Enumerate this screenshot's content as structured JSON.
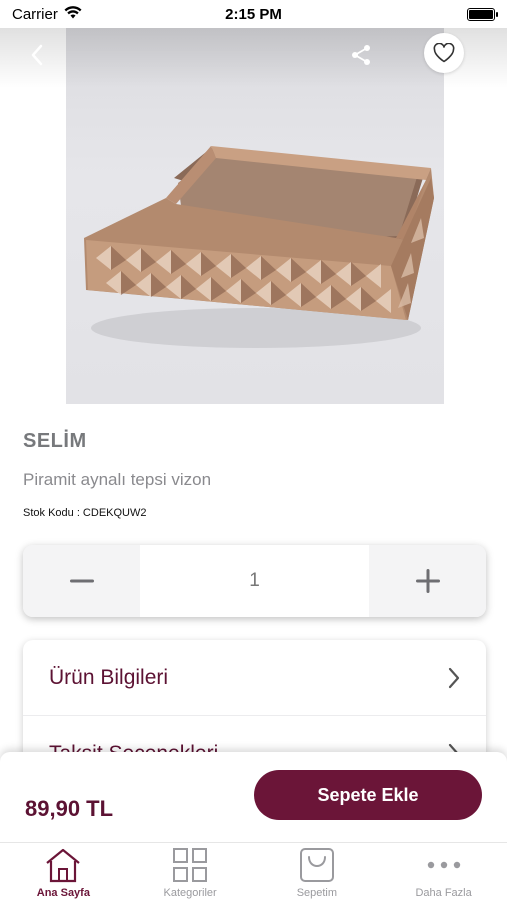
{
  "status_bar": {
    "carrier": "Carrier",
    "time": "2:15 PM"
  },
  "product": {
    "brand": "SELİM",
    "name": "Piramit aynalı tepsi vizon",
    "sku_label": "Stok Kodu : CDEKQUW2"
  },
  "quantity": {
    "value": "1"
  },
  "info_rows": [
    {
      "label": "Ürün Bilgileri"
    },
    {
      "label": "Taksit Seçenekleri"
    }
  ],
  "cart": {
    "price": "89,90 TL",
    "add_label": "Sepete Ekle"
  },
  "tabs": [
    {
      "label": "Ana Sayfa",
      "icon": "home-icon",
      "active": true
    },
    {
      "label": "Kategoriler",
      "icon": "grid-icon",
      "active": false
    },
    {
      "label": "Sepetim",
      "icon": "bag-icon",
      "active": false
    },
    {
      "label": "Daha Fazla",
      "icon": "more-icon",
      "active": false
    }
  ],
  "colors": {
    "accent": "#6b1538",
    "brand_text": "#77797c"
  }
}
